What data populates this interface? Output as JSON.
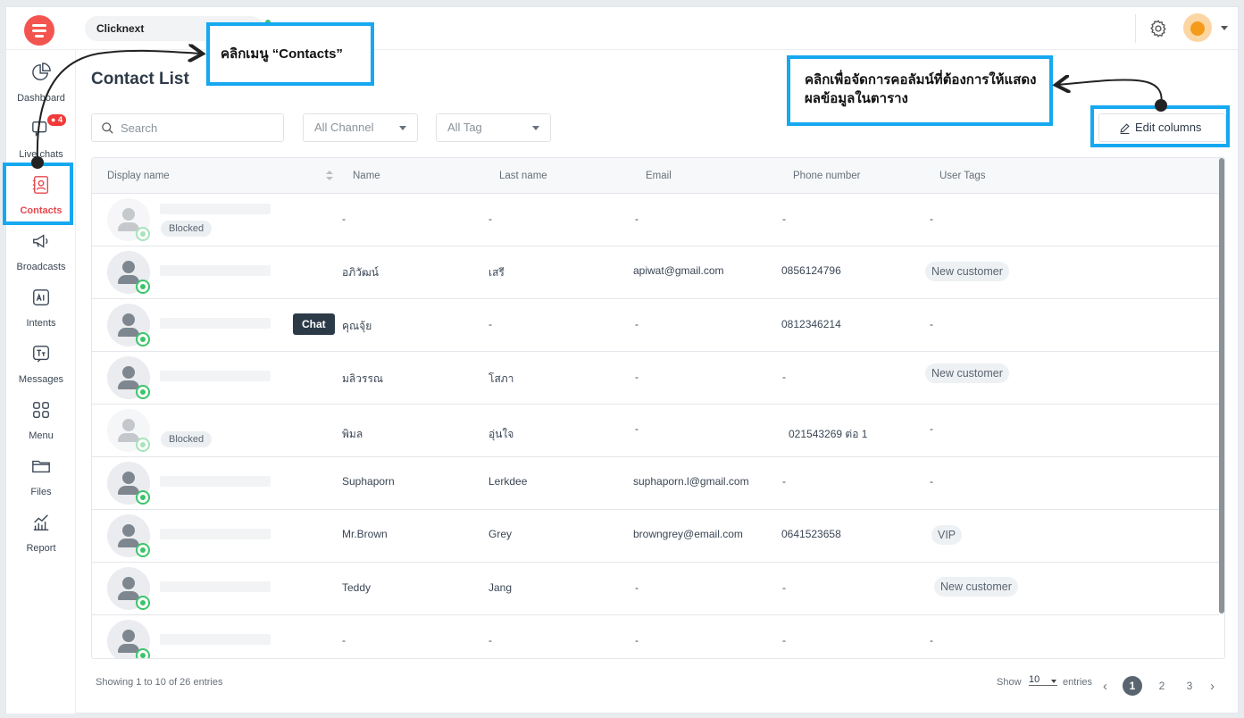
{
  "app": {
    "workspace": "Clicknext",
    "icons": {
      "logo": "logo-icon",
      "settings": "gear-icon",
      "avatar": "user-avatar"
    }
  },
  "sidebar": {
    "items": [
      {
        "label": "Dashboard",
        "icon": "pie-chart-icon"
      },
      {
        "label": "Live chats",
        "icon": "chat-icon",
        "badge": "4"
      },
      {
        "label": "Contacts",
        "icon": "contacts-icon",
        "active": true
      },
      {
        "label": "Broadcasts",
        "icon": "megaphone-icon"
      },
      {
        "label": "Intents",
        "icon": "ai-icon"
      },
      {
        "label": "Messages",
        "icon": "text-icon"
      },
      {
        "label": "Menu",
        "icon": "grid-icon"
      },
      {
        "label": "Files",
        "icon": "folder-icon"
      },
      {
        "label": "Report",
        "icon": "report-icon"
      }
    ]
  },
  "page": {
    "title": "Contact List"
  },
  "filters": {
    "search_placeholder": "Search",
    "channel": "All Channel",
    "tag": "All Tag",
    "edit_columns": "Edit columns"
  },
  "table": {
    "columns": [
      "Display name",
      "Name",
      "Last name",
      "Email",
      "Phone number",
      "User Tags"
    ],
    "rows": [
      {
        "blocked": "Blocked",
        "name": "-",
        "last": "-",
        "email": "-",
        "phone": "-",
        "tag": "-"
      },
      {
        "blocked": "",
        "name": "อภิวัฒน์",
        "last": "เสรี",
        "email": "apiwat@gmail.com",
        "phone": "0856124796",
        "tag": "New customer"
      },
      {
        "blocked": "",
        "name": "คุณจุ้ย",
        "last": "-",
        "email": "-",
        "phone": "0812346214",
        "tag": "-"
      },
      {
        "blocked": "",
        "name": "มลิวรรณ",
        "last": "โสภา",
        "email": "-",
        "phone": "-",
        "tag": "New customer"
      },
      {
        "blocked": "Blocked",
        "name": "พิมล",
        "last": "อุ่นใจ",
        "email": "-",
        "phone": "021543269 ต่อ 1",
        "tag": "-"
      },
      {
        "blocked": "",
        "name": "Suphaporn",
        "last": "Lerkdee",
        "email": "suphaporn.l@gmail.com",
        "phone": "-",
        "tag": "-"
      },
      {
        "blocked": "",
        "name": "Mr.Brown",
        "last": "Grey",
        "email": "browngrey@email.com",
        "phone": "0641523658",
        "tag": "VIP"
      },
      {
        "blocked": "",
        "name": "Teddy",
        "last": "Jang",
        "email": "-",
        "phone": "-",
        "tag": "New customer"
      },
      {
        "blocked": "",
        "name": "-",
        "last": "-",
        "email": "-",
        "phone": "-",
        "tag": "-"
      }
    ],
    "tooltip": "Chat"
  },
  "footer": {
    "info": "Showing 1 to 10 of 26 entries",
    "show": "Show",
    "page_size": "10",
    "entries": "entries",
    "pages": [
      "1",
      "2",
      "3"
    ],
    "current_page": "1"
  },
  "annotations": {
    "callout_contacts": "คลิกเมนู “Contacts”",
    "callout_columns": "คลิกเพื่อจัดการคอลัมน์ที่ต้องการให้แสดงผลข้อมูลในตาราง",
    "color": "#16a8f0"
  }
}
